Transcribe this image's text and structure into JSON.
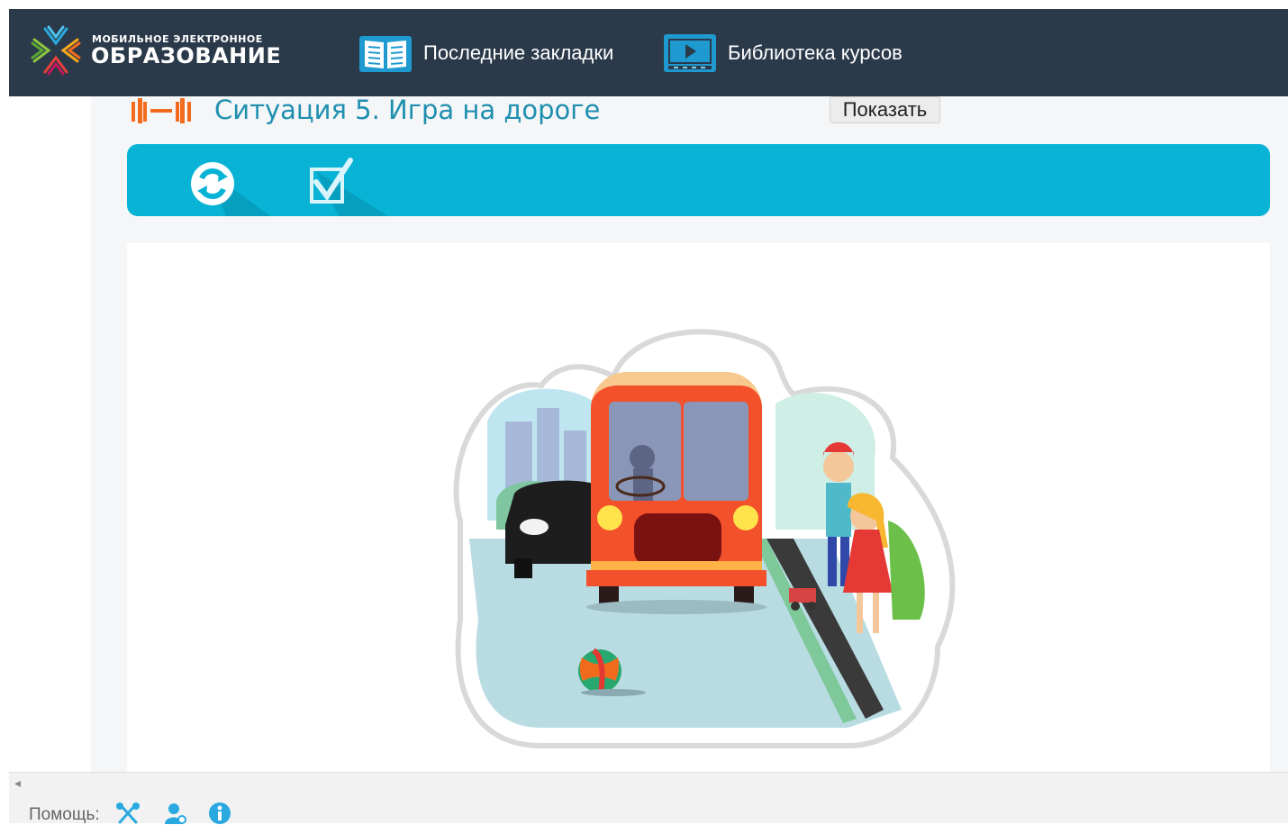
{
  "header": {
    "logo_small": "МОБИЛЬНОЕ ЭЛЕКТРОННОЕ",
    "logo_big": "ОБРАЗОВАНИЕ",
    "nav": [
      {
        "label": "Последние закладки",
        "icon": "open-book-icon"
      },
      {
        "label": "Библиотека курсов",
        "icon": "video-library-icon"
      }
    ]
  },
  "lesson": {
    "title": "Ситуация 5. Игра на дороге",
    "title_icon": "exercise-dumbbell-icon",
    "show_button": "Показать"
  },
  "toolbar": {
    "buttons": [
      {
        "icon": "refresh-icon",
        "action": "reset"
      },
      {
        "icon": "checkbox-check-icon",
        "action": "check"
      }
    ]
  },
  "stage": {
    "image": "road-safety-illustration: bus, car, children, ball on road"
  },
  "footer": {
    "help_label": "Помощь:",
    "help_icons": [
      "tools-icon",
      "user-support-icon",
      "info-icon"
    ]
  },
  "colors": {
    "header_bg": "#2b3a4a",
    "toolbar_bg": "#09b3d6",
    "title_color": "#1f8fb0",
    "accent_orange": "#f26b1d"
  }
}
